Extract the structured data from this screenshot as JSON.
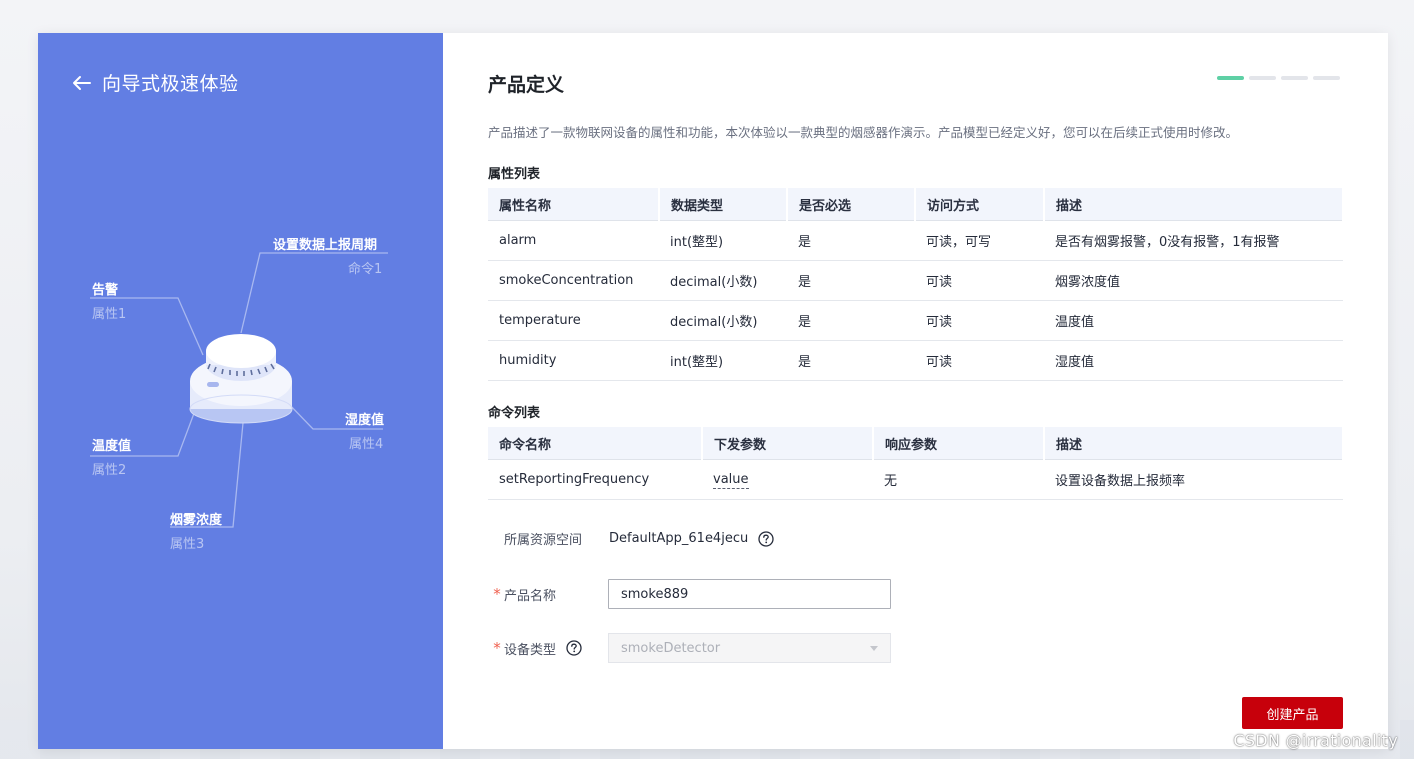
{
  "wizard": {
    "back_title": "向导式极速体验",
    "diagram": {
      "cmd_label": "设置数据上报周期",
      "cmd_sub": "命令1",
      "alarm_label": "告警",
      "alarm_sub": "属性1",
      "humid_label": "湿度值",
      "humid_sub": "属性4",
      "temp_label": "温度值",
      "temp_sub": "属性2",
      "smoke_label": "烟雾浓度",
      "smoke_sub": "属性3"
    }
  },
  "page": {
    "title": "产品定义",
    "description": "产品描述了一款物联网设备的属性和功能，本次体验以一款典型的烟感器作演示。产品模型已经定义好，您可以在后续正式使用时修改。",
    "steps": {
      "count": 4,
      "active_index": 0
    }
  },
  "properties": {
    "section_title": "属性列表",
    "headers": [
      "属性名称",
      "数据类型",
      "是否必选",
      "访问方式",
      "描述"
    ],
    "rows": [
      [
        "alarm",
        "int(整型)",
        "是",
        "可读，可写",
        "是否有烟雾报警，0没有报警，1有报警"
      ],
      [
        "smokeConcentration",
        "decimal(小数)",
        "是",
        "可读",
        "烟雾浓度值"
      ],
      [
        "temperature",
        "decimal(小数)",
        "是",
        "可读",
        "温度值"
      ],
      [
        "humidity",
        "int(整型)",
        "是",
        "可读",
        "湿度值"
      ]
    ]
  },
  "commands": {
    "section_title": "命令列表",
    "headers": [
      "命令名称",
      "下发参数",
      "响应参数",
      "描述"
    ],
    "rows": [
      [
        "setReportingFrequency",
        "value",
        "无",
        "设置设备数据上报频率"
      ]
    ]
  },
  "form": {
    "resource_space_label": "所属资源空间",
    "resource_space_value": "DefaultApp_61e4jecu",
    "product_name_label": "产品名称",
    "product_name_value": "smoke889",
    "device_type_label": "设备类型",
    "device_type_value": "smokeDetector",
    "required_mark": "*"
  },
  "actions": {
    "create_label": "创建产品"
  },
  "watermark": "CSDN @irrationality",
  "colors": {
    "left_panel": "#627ee3",
    "step_active": "#5ed0a5",
    "primary_button": "#c7000b",
    "required": "#f0604f"
  },
  "icons": [
    "back-arrow-icon",
    "help-icon",
    "smoke-detector-illustration",
    "caret-down-icon"
  ]
}
